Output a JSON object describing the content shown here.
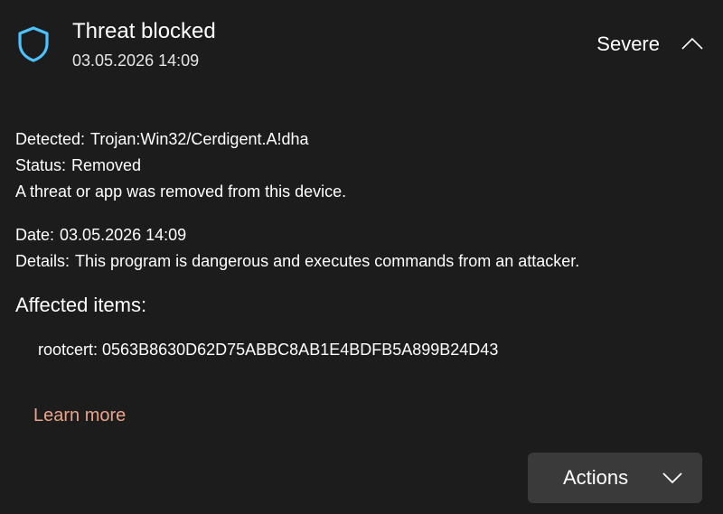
{
  "header": {
    "title": "Threat blocked",
    "timestamp": "03.05.2026 14:09",
    "severity": "Severe",
    "shield_icon": "shield-icon",
    "toggle_icon": "chevron-up-icon"
  },
  "details": {
    "detected_label": "Detected:",
    "detected_value": "Trojan:Win32/Cerdigent.A!dha",
    "status_label": "Status:",
    "status_value": "Removed",
    "status_message": "A threat or app was removed from this device.",
    "date_label": "Date:",
    "date_value": "03.05.2026 14:09",
    "details_label": "Details:",
    "details_value": "This program is dangerous and executes commands from an attacker."
  },
  "affected": {
    "heading": "Affected items:",
    "items": [
      "rootcert: 0563B8630D62D75ABBC8AB1E4BDFB5A899B24D43"
    ]
  },
  "links": {
    "learn_more": "Learn more"
  },
  "actions": {
    "label": "Actions",
    "icon": "chevron-down-icon"
  },
  "colors": {
    "background": "#1c1c1c",
    "accent_shield": "#4cc2ff",
    "link": "#e9a38a",
    "button": "#3a3a3a"
  }
}
